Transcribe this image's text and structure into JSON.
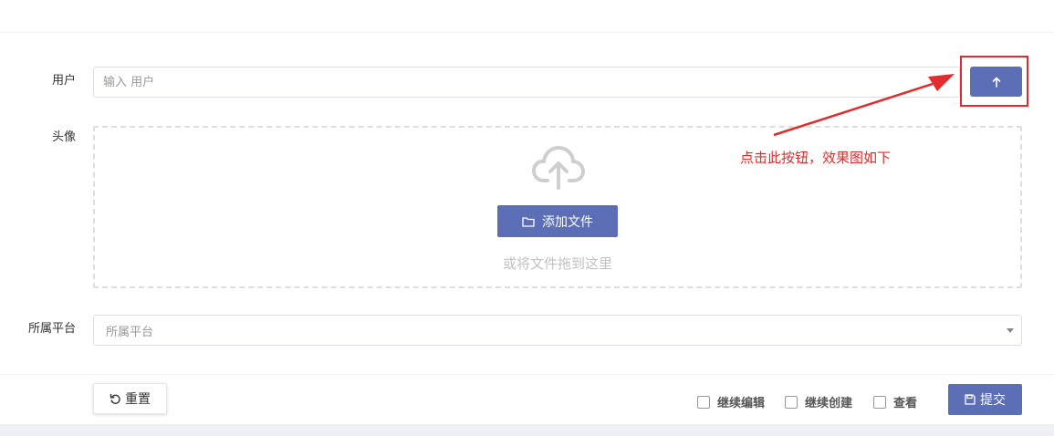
{
  "form": {
    "user": {
      "label": "用户",
      "placeholder": "输入 用户"
    },
    "avatar": {
      "label": "头像",
      "add_file_label": "添加文件",
      "drop_hint": "或将文件拖到这里"
    },
    "platform": {
      "label": "所属平台",
      "placeholder": "所属平台"
    }
  },
  "annotation": {
    "text": "点击此按钮，效果图如下"
  },
  "footer": {
    "reset_label": "重置",
    "checkboxes": [
      {
        "label": "继续编辑"
      },
      {
        "label": "继续创建"
      },
      {
        "label": "查看"
      }
    ],
    "submit_label": "提交"
  },
  "colors": {
    "primary": "#5b6eb6",
    "annotation": "#e02c2c",
    "dropzone_border": "#dedede"
  },
  "icons": {
    "upload_button": "arrow-up-icon",
    "dropzone": "cloud-upload-icon",
    "add_file": "folder-icon",
    "reset": "undo-icon",
    "submit": "save-icon"
  }
}
